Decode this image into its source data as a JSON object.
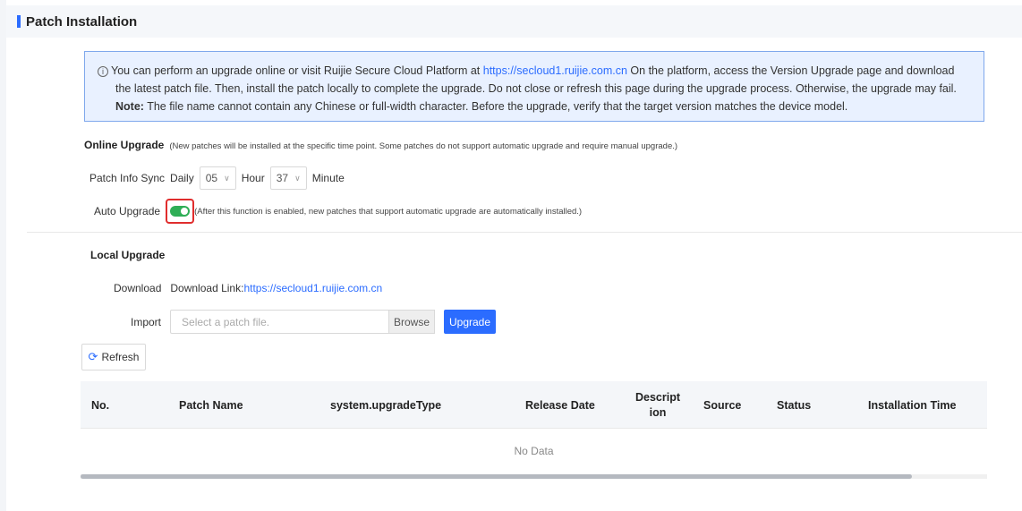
{
  "page": {
    "title": "Patch Installation"
  },
  "notice": {
    "icon": "info-icon",
    "line1_text": "You can perform an upgrade online or visit Ruijie Secure Cloud Platform at ",
    "line1_link": "https://secloud1.ruijie.com.cn",
    "line1_tail": " On the platform, access the Version Upgrade page and download",
    "line2": "the latest patch file. Then, install the patch locally to complete the upgrade. Do not close or refresh this page during the upgrade process. Otherwise, the upgrade may fail.",
    "note_label": "Note:",
    "note_text": " The file name cannot contain any Chinese or full-width character. Before the upgrade, verify that the target version matches the device model."
  },
  "online_upgrade": {
    "label": "Online Upgrade",
    "hint": "(New patches will be installed at the specific time point. Some patches do not support automatic upgrade and require manual upgrade.)",
    "sync_label": "Patch Info Sync",
    "daily_label": "Daily",
    "hour_value": "05",
    "hour_label": "Hour",
    "minute_value": "37",
    "minute_label": "Minute",
    "auto_label": "Auto Upgrade",
    "auto_enabled": true,
    "auto_hint": "(After this function is enabled, new patches that support automatic upgrade are automatically installed.)"
  },
  "local_upgrade": {
    "label": "Local Upgrade",
    "download_label": "Download",
    "download_prefix": "Download Link:",
    "download_link": "https://secloud1.ruijie.com.cn",
    "import_label": "Import",
    "file_placeholder": "Select a patch file.",
    "browse_label": "Browse",
    "upgrade_label": "Upgrade"
  },
  "toolbar": {
    "refresh_label": "Refresh"
  },
  "table": {
    "columns": [
      "No.",
      "Patch Name",
      "system.upgradeType",
      "Release Date",
      "Descript ion",
      "Source",
      "Status",
      "Installation Time"
    ],
    "rows": [],
    "empty_text": "No Data"
  },
  "colors": {
    "accent": "#2b6cff",
    "toggle_on": "#2fae56",
    "highlight": "#e02d2d",
    "notice_bg": "#e9f1ff"
  }
}
